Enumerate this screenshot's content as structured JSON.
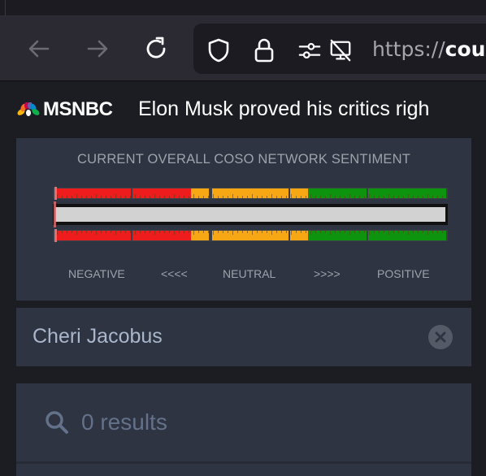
{
  "browser": {
    "nav": {
      "back_icon": "arrow-left-icon",
      "forward_icon": "arrow-right-icon",
      "reload_icon": "reload-icon"
    },
    "url_bar": {
      "icons": [
        "shield-icon",
        "lock-icon",
        "permissions-icon",
        "camera-off-icon"
      ],
      "url_prefix": "https://",
      "url_host": "cou"
    }
  },
  "page": {
    "source_logo": "MSNBC",
    "headline": "Elon Musk proved his critics righ",
    "sentiment_panel": {
      "title": "CURRENT OVERALL COSO NETWORK SENTIMENT",
      "labels": {
        "negative": "NEGATIVE",
        "left_arrows": "<<<<",
        "neutral": "NEUTRAL",
        "right_arrows": ">>>>",
        "positive": "POSITIVE"
      },
      "level_fraction": 0.0,
      "colors": {
        "negative": "#ee1c1c",
        "neutral": "#f7a714",
        "positive": "#0e930e",
        "track": "#d2d2d2",
        "indicator": "#e66e6e"
      }
    },
    "search": {
      "value": "Cheri Jacobus",
      "clear_icon": "clear-icon"
    },
    "results": {
      "icon": "search-icon",
      "text": "0 results"
    }
  }
}
